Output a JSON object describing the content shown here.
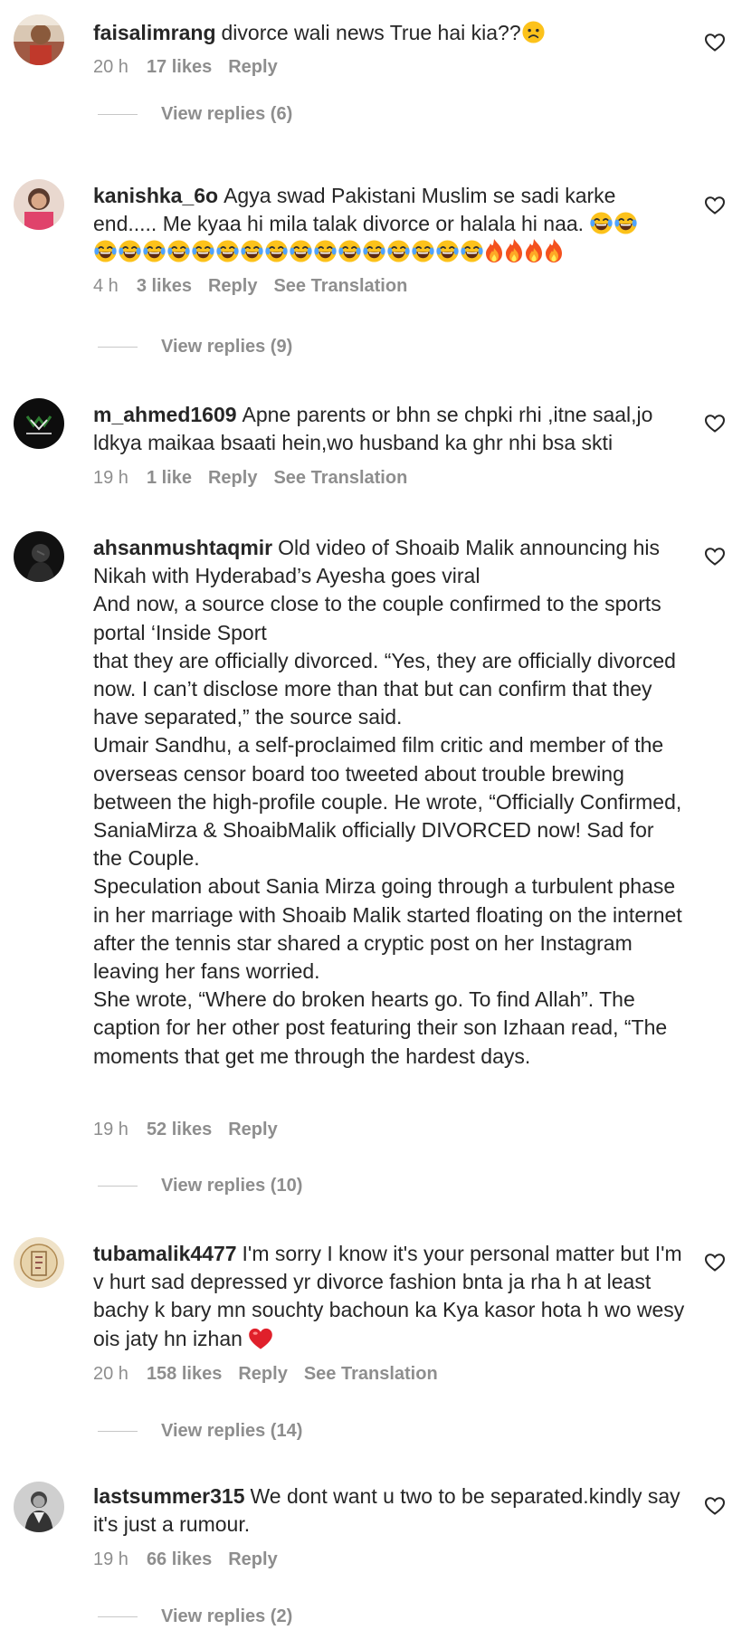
{
  "comments": [
    {
      "username": "faisalimrang",
      "text": "divorce wali news True hai kia??",
      "time": "20 h",
      "likes": "17 likes",
      "reply": "Reply",
      "view_replies": "View replies (6)"
    },
    {
      "username": "kanishka_6o",
      "text_line1": "Agya swad Pakistani Muslim se sadi karke",
      "text_line2": "end..... Me kyaa hi mila talak divorce or halala hi naa.",
      "time": "4 h",
      "likes": "3 likes",
      "reply": "Reply",
      "translate": "See Translation",
      "view_replies": "View replies (9)"
    },
    {
      "username": "m_ahmed1609",
      "text": "Apne parents or bhn se chpki rhi ,itne saal,jo ldkya maikaa bsaati hein,wo husband ka ghr nhi bsa skti",
      "time": "19 h",
      "likes": "1 like",
      "reply": "Reply",
      "translate": "See Translation"
    },
    {
      "username": "ahsanmushtaqmir",
      "text_lines": [
        "Old video of Shoaib Malik announcing his Nikah with Hyderabad’s Ayesha goes viral",
        "And now, a source close to the couple confirmed to the sports portal ‘Inside Sport",
        "that they are officially divorced. “Yes, they are officially divorced now. I can’t disclose more than that but can confirm that they have separated,” the source said.",
        "Umair Sandhu, a self-proclaimed film critic and member of the overseas censor board too tweeted about trouble brewing between the high-profile couple. He wrote, “Officially Confirmed,",
        "SaniaMirza & ShoaibMalik officially DIVORCED now! Sad for the Couple.",
        "Speculation about Sania Mirza going through a turbulent phase in her marriage with Shoaib Malik started floating on the internet after the tennis star shared a cryptic post on her Instagram leaving her fans worried.",
        "She wrote, “Where do broken hearts go. To find Allah”. The caption for her other post featuring their son Izhaan read, “The moments that get me through the hardest days."
      ],
      "time": "19 h",
      "likes": "52 likes",
      "reply": "Reply",
      "view_replies": "View replies (10)"
    },
    {
      "username": "tubamalik4477",
      "text": "I'm sorry I know it's your personal matter but I'm v hurt sad depressed yr divorce fashion bnta ja rha h at least bachy k bary mn souchty bachoun ka Kya kasor hota h wo wesy ois jaty hn izhan",
      "time": "20 h",
      "likes": "158 likes",
      "reply": "Reply",
      "translate": "See Translation",
      "view_replies": "View replies (14)"
    },
    {
      "username": "lastsummer315",
      "text": "We dont want u two to be separated.kindly say it's just a rumour.",
      "time": "19 h",
      "likes": "66 likes",
      "reply": "Reply",
      "view_replies": "View replies (2)"
    }
  ],
  "icons": {
    "like": "heart-outline-icon",
    "emoji_sad": "sad-face-emoji",
    "emoji_laugh": "tears-of-joy-emoji",
    "emoji_fire": "fire-emoji",
    "emoji_heart": "red-heart-emoji"
  },
  "colors": {
    "text": "#262626",
    "secondary": "#8e8e8e",
    "divider": "#c7c7c7",
    "background": "#ffffff"
  }
}
